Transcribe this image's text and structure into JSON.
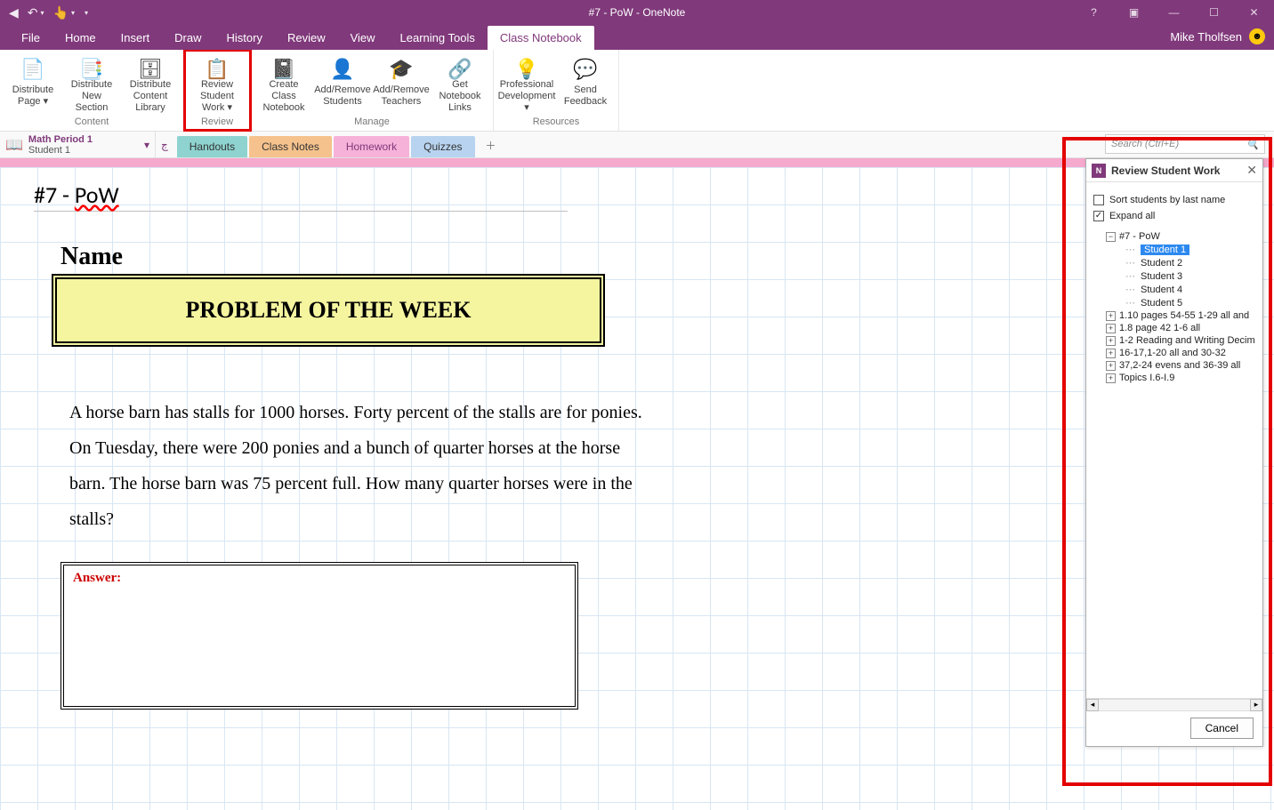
{
  "titlebar": {
    "title": "#7 - PoW - OneNote"
  },
  "user": {
    "name": "Mike Tholfsen"
  },
  "menu": {
    "tabs": [
      "File",
      "Home",
      "Insert",
      "Draw",
      "History",
      "Review",
      "View",
      "Learning Tools",
      "Class Notebook"
    ],
    "active": "Class Notebook"
  },
  "ribbon": {
    "groups": [
      {
        "label": "Content",
        "items": [
          {
            "name": "distribute-page",
            "label": "Distribute Page ▾",
            "icon": "📄"
          },
          {
            "name": "distribute-new-section",
            "label": "Distribute New Section",
            "icon": "📑"
          },
          {
            "name": "distribute-content-library",
            "label": "Distribute Content Library",
            "icon": "🗄"
          }
        ]
      },
      {
        "label": "Review",
        "highlight": true,
        "items": [
          {
            "name": "review-student-work",
            "label": "Review Student Work ▾",
            "icon": "📋"
          }
        ]
      },
      {
        "label": "Manage",
        "items": [
          {
            "name": "create-class-notebook",
            "label": "Create Class Notebook",
            "icon": "📓"
          },
          {
            "name": "add-remove-students",
            "label": "Add/Remove Students",
            "icon": "👤"
          },
          {
            "name": "add-remove-teachers",
            "label": "Add/Remove Teachers",
            "icon": "🎓"
          },
          {
            "name": "get-notebook-links",
            "label": "Get Notebook Links",
            "icon": "🔗"
          }
        ]
      },
      {
        "label": "Resources",
        "items": [
          {
            "name": "professional-development",
            "label": "Professional Development ▾",
            "icon": "💡"
          },
          {
            "name": "send-feedback",
            "label": "Send Feedback",
            "icon": "💬"
          }
        ]
      }
    ]
  },
  "notebook": {
    "name": "Math Period 1",
    "sub": "Student 1"
  },
  "sections": {
    "tabs": [
      {
        "name": "handouts",
        "label": "Handouts",
        "class": "tab-handouts"
      },
      {
        "name": "class-notes",
        "label": "Class Notes",
        "class": "tab-classnotes"
      },
      {
        "name": "homework",
        "label": "Homework",
        "class": "tab-homework",
        "active": true
      },
      {
        "name": "quizzes",
        "label": "Quizzes",
        "class": "tab-quizzes"
      }
    ]
  },
  "search": {
    "placeholder": "Search (Ctrl+E)"
  },
  "page": {
    "title_prefix": "#7 - ",
    "title_typo": "PoW",
    "name_label": "Name",
    "potw": "PROBLEM OF THE WEEK",
    "problem": "A horse barn has stalls for 1000 horses. Forty percent of the stalls are for ponies. On Tuesday, there were 200 ponies and a bunch of quarter horses at the horse barn. The horse barn was 75 percent full. How many quarter horses were in the stalls?",
    "answer_label": "Answer:"
  },
  "panel": {
    "title": "Review Student Work",
    "sort_label": "Sort students by last name",
    "sort_checked": false,
    "expand_label": "Expand all",
    "expand_checked": true,
    "tree_root": "#7 - PoW",
    "students": [
      "Student 1",
      "Student 2",
      "Student 3",
      "Student 4",
      "Student 5"
    ],
    "selected_student": "Student 1",
    "other_pages": [
      "1.10 pages 54-55 1-29 all and",
      "1.8 page 42 1-6 all",
      "1-2 Reading and Writing Decim",
      "16-17,1-20 all and 30-32",
      "37,2-24 evens and 36-39 all",
      "Topics I.6-I.9"
    ],
    "cancel": "Cancel"
  }
}
